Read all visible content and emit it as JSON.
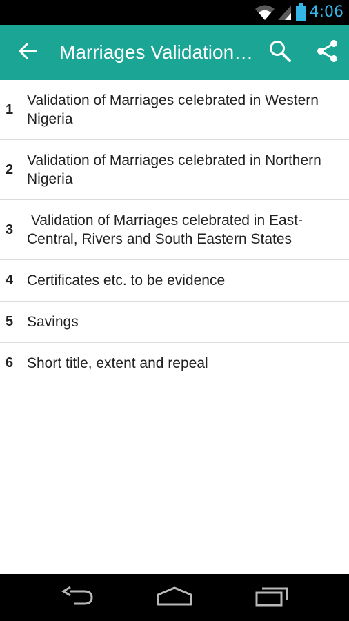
{
  "status_bar": {
    "time": "4:06",
    "accent_color": "#33b5e5",
    "icons": [
      "wifi-icon",
      "cell-signal-icon",
      "battery-icon"
    ]
  },
  "app_bar": {
    "title": "Marriages Validation Act",
    "background_color": "#1aa594",
    "icons": [
      "back-arrow-icon",
      "search-icon",
      "share-icon"
    ]
  },
  "sections": [
    {
      "number": "1",
      "title": "Validation of Marriages celebrated in Western Nigeria"
    },
    {
      "number": "2",
      "title": "Validation of Marriages celebrated in Northern Nigeria"
    },
    {
      "number": "3",
      "title": " Validation of Marriages celebrated in East-Central, Rivers and South Eastern States"
    },
    {
      "number": "4",
      "title": "Certificates etc. to be evidence"
    },
    {
      "number": "5",
      "title": "Savings"
    },
    {
      "number": "6",
      "title": "Short title, extent and repeal"
    }
  ],
  "nav_bar": {
    "icons": [
      "nav-back-icon",
      "nav-home-icon",
      "nav-recent-apps-icon"
    ]
  }
}
